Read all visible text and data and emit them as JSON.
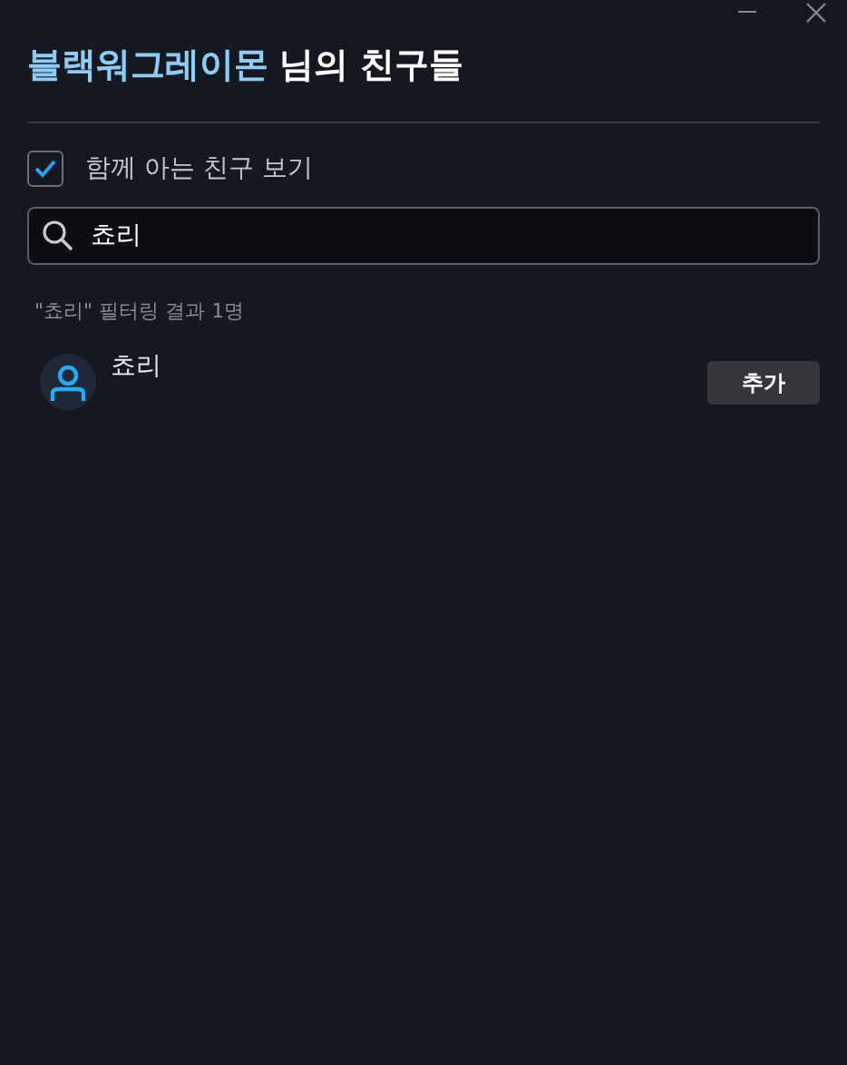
{
  "title": {
    "owner": "블랙워그레이몬",
    "suffix": "님의 친구들"
  },
  "mutual_filter": {
    "label": "함께 아는 친구 보기",
    "checked": true
  },
  "search": {
    "value": "쵸리"
  },
  "result_count": "\"쵸리\" 필터링 결과 1명",
  "friends": [
    {
      "name": "쵸리",
      "action": "추가"
    }
  ]
}
